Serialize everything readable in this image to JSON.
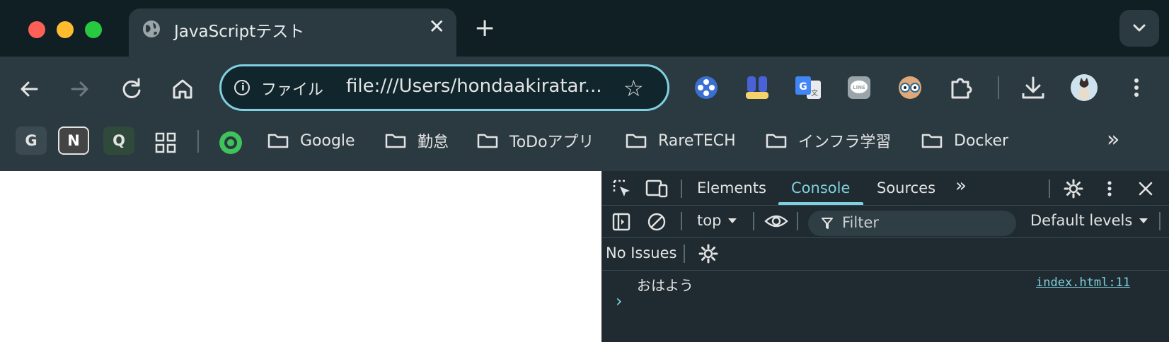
{
  "tab": {
    "title": "JavaScriptテスト",
    "close": "✕"
  },
  "new_tab": "+",
  "omnibox": {
    "chip": "ファイル",
    "url": "file:///Users/hondaakiratar...",
    "star": "☆"
  },
  "bookmarks": {
    "letters": [
      "G",
      "N",
      "Q"
    ],
    "folders": [
      "Google",
      "勤怠",
      "ToDoアプリ",
      "RareTECH",
      "インフラ学習",
      "Docker"
    ],
    "more": "»"
  },
  "devtools": {
    "tabs": [
      "Elements",
      "Console",
      "Sources"
    ],
    "more_tabs": "»",
    "context": "top",
    "filter_placeholder": "Filter",
    "levels": "Default levels",
    "issues": "No Issues",
    "log": {
      "message": "おはよう",
      "source": "index.html:11"
    },
    "prompt": "›"
  },
  "colors": {
    "accent": "#7fd0e0",
    "toolbar": "#2a3a40",
    "tabstrip": "#0f1f24"
  }
}
